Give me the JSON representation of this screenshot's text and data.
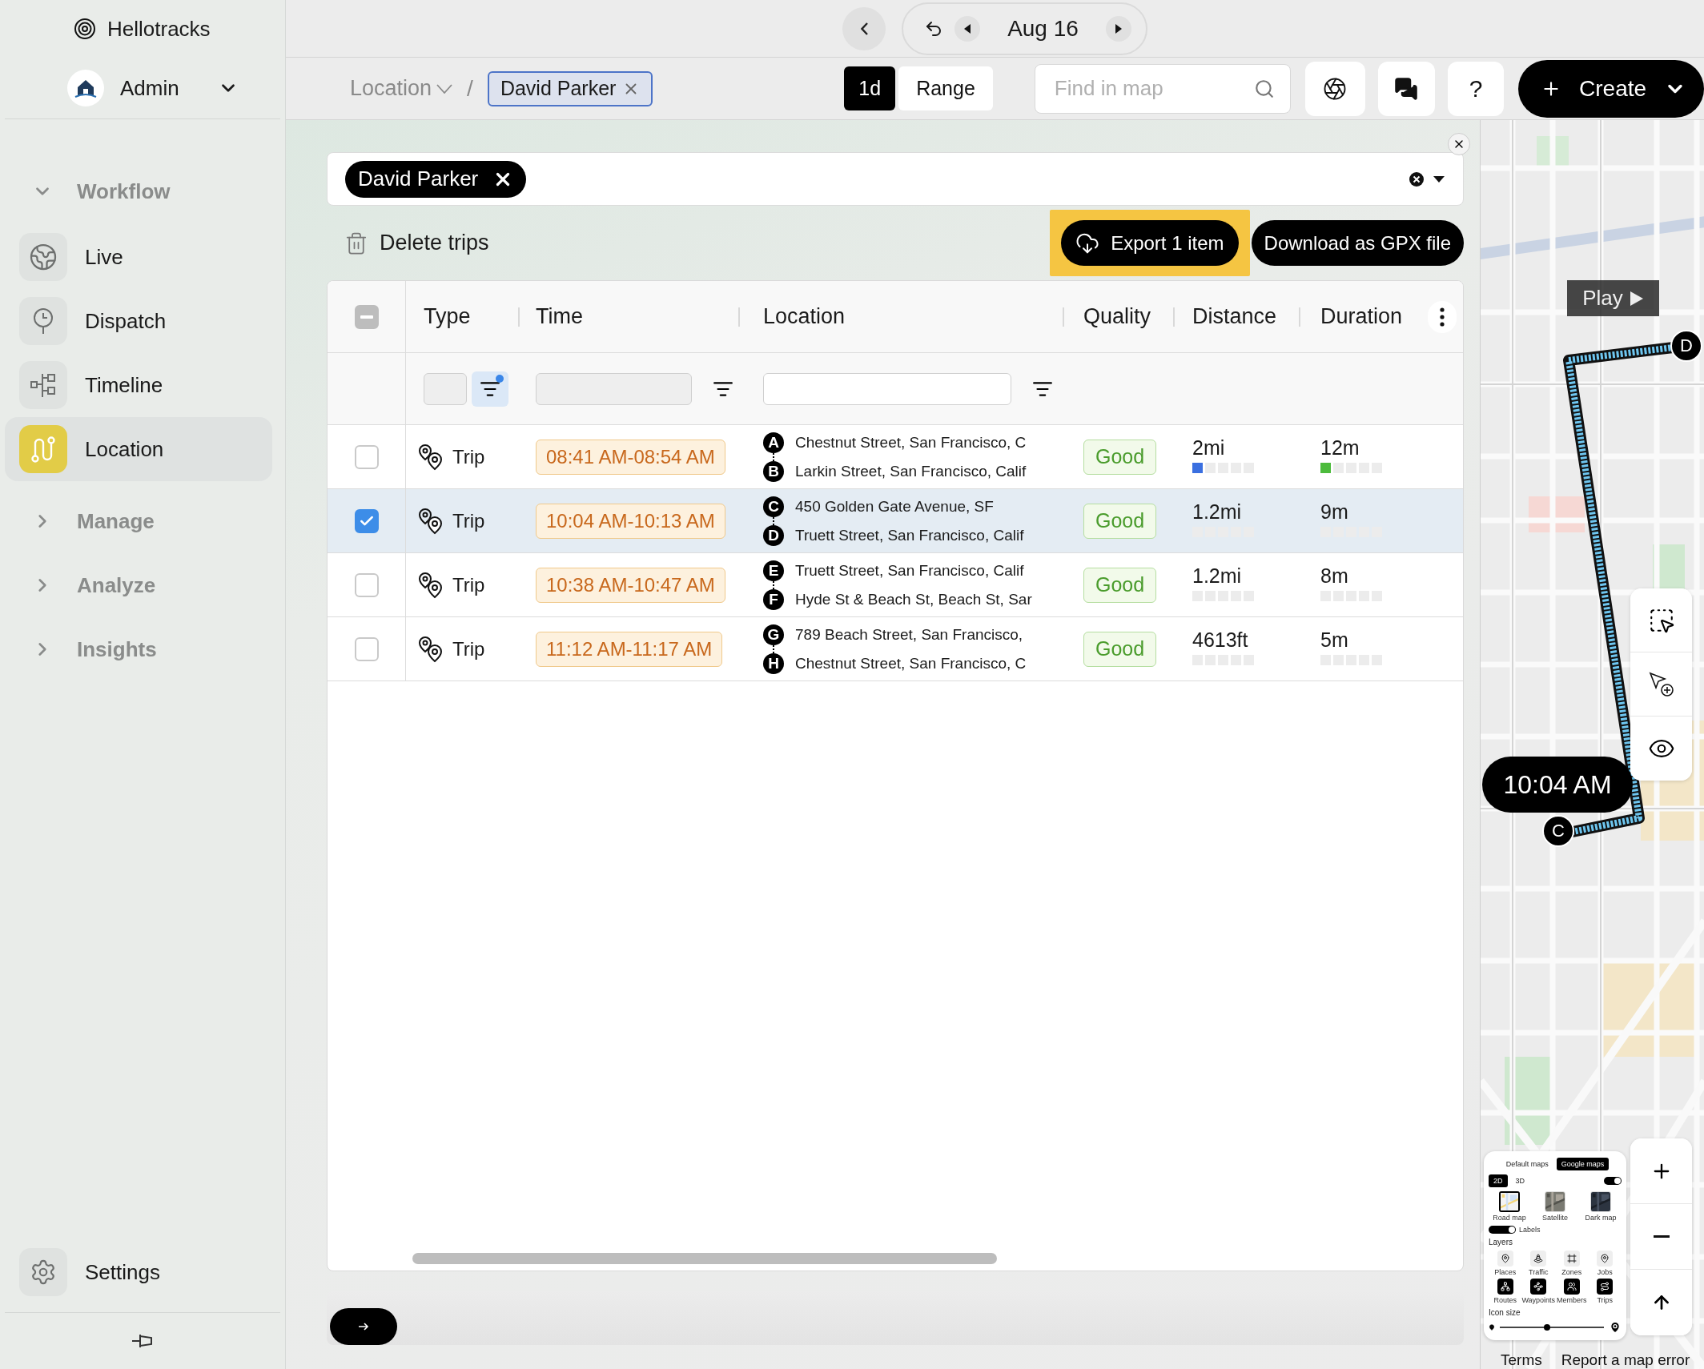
{
  "sidebar": {
    "brand": "Hellotracks",
    "account": {
      "name": "Admin"
    },
    "groups": [
      {
        "label": "Workflow",
        "expanded": true,
        "items": [
          {
            "label": "Live",
            "kind": "globe",
            "selected": false
          },
          {
            "label": "Dispatch",
            "kind": "signpost",
            "selected": false
          },
          {
            "label": "Timeline",
            "kind": "timeline",
            "selected": false
          },
          {
            "label": "Location",
            "kind": "route",
            "selected": true
          }
        ]
      },
      {
        "label": "Manage",
        "expanded": false
      },
      {
        "label": "Analyze",
        "expanded": false
      },
      {
        "label": "Insights",
        "expanded": false
      }
    ],
    "settings": {
      "label": "Settings"
    }
  },
  "date_nav": {
    "date": "Aug 16"
  },
  "breadcrumb": {
    "section": "Location",
    "separator": "/",
    "chip": "David Parker"
  },
  "range_toggle": [
    {
      "label": "1d",
      "selected": true
    },
    {
      "label": "Range",
      "selected": false
    }
  ],
  "search": {
    "placeholder": "Find in map"
  },
  "help": "?",
  "create": "Create",
  "filter_bar": {
    "chips": [
      "David Parker"
    ]
  },
  "actions": {
    "delete": "Delete trips",
    "export": {
      "label": "Export 1 item",
      "highlighted": true
    },
    "gpx": "Download as GPX file"
  },
  "table": {
    "select_all_partial": true,
    "columns": [
      {
        "label": "Type",
        "kind": "chip",
        "filter_active": true
      },
      {
        "label": "Time",
        "kind": "select",
        "filter_active": false
      },
      {
        "label": "Location",
        "kind": "text",
        "filter_active": false
      },
      {
        "label": "Quality",
        "kind": "plain"
      },
      {
        "label": "Distance",
        "kind": "plain"
      },
      {
        "label": "Duration",
        "kind": "plain"
      }
    ],
    "rows": [
      {
        "selected": false,
        "type": "Trip",
        "time": "08:41 AM-08:54 AM",
        "stops": [
          {
            "mark": "A",
            "address": "Chestnut Street, San Francisco, C"
          },
          {
            "mark": "B",
            "address": "Larkin Street, San Francisco, Calif"
          }
        ],
        "quality": "Good",
        "distance": {
          "value": "2mi",
          "level": 0.2
        },
        "duration": {
          "value": "12m",
          "level": 0.2
        }
      },
      {
        "selected": true,
        "type": "Trip",
        "time": "10:04 AM-10:13 AM",
        "stops": [
          {
            "mark": "C",
            "address": "450 Golden Gate Avenue, SF"
          },
          {
            "mark": "D",
            "address": "Truett Street, San Francisco, Calif"
          }
        ],
        "quality": "Good",
        "distance": {
          "value": "1.2mi",
          "level": 0
        },
        "duration": {
          "value": "9m",
          "level": 0
        }
      },
      {
        "selected": false,
        "type": "Trip",
        "time": "10:38 AM-10:47 AM",
        "stops": [
          {
            "mark": "E",
            "address": "Truett Street, San Francisco, Calif"
          },
          {
            "mark": "F",
            "address": "Hyde St & Beach St, Beach St, Sar"
          }
        ],
        "quality": "Good",
        "distance": {
          "value": "1.2mi",
          "level": 0
        },
        "duration": {
          "value": "8m",
          "level": 0
        }
      },
      {
        "selected": false,
        "type": "Trip",
        "time": "11:12 AM-11:17 AM",
        "stops": [
          {
            "mark": "G",
            "address": "789 Beach Street, San Francisco,"
          },
          {
            "mark": "H",
            "address": "Chestnut Street, San Francisco, C"
          }
        ],
        "quality": "Good",
        "distance": {
          "value": "4613ft",
          "level": 0
        },
        "duration": {
          "value": "5m",
          "level": 0
        }
      }
    ]
  },
  "map": {
    "play": "Play",
    "time_badge": "10:04 AM",
    "markers": [
      {
        "label": "D"
      },
      {
        "label": "C"
      }
    ],
    "layers_panel": {
      "sources": [
        {
          "label": "Default maps",
          "selected": false
        },
        {
          "label": "Google maps",
          "selected": true
        }
      ],
      "modes": [
        {
          "label": "2D",
          "selected": true
        },
        {
          "label": "3D",
          "selected": false
        }
      ],
      "tilt_on": true,
      "styles": [
        {
          "label": "Road map",
          "kind": "road",
          "selected": true
        },
        {
          "label": "Satellite",
          "kind": "satellite",
          "selected": false
        },
        {
          "label": "Dark map",
          "kind": "dark",
          "selected": false
        }
      ],
      "labels": {
        "label": "Labels",
        "on": true
      },
      "title": "Layers",
      "layers": [
        {
          "label": "Places",
          "on": false
        },
        {
          "label": "Traffic",
          "on": false
        },
        {
          "label": "Zones",
          "on": false
        },
        {
          "label": "Jobs",
          "on": false
        },
        {
          "label": "Routes",
          "on": true
        },
        {
          "label": "Waypoints",
          "on": true
        },
        {
          "label": "Members",
          "on": true
        },
        {
          "label": "Trips",
          "on": true
        }
      ],
      "icon_size": {
        "label": "Icon size",
        "level": 0.45
      }
    },
    "footer": [
      "Terms",
      "Report a map error"
    ]
  }
}
